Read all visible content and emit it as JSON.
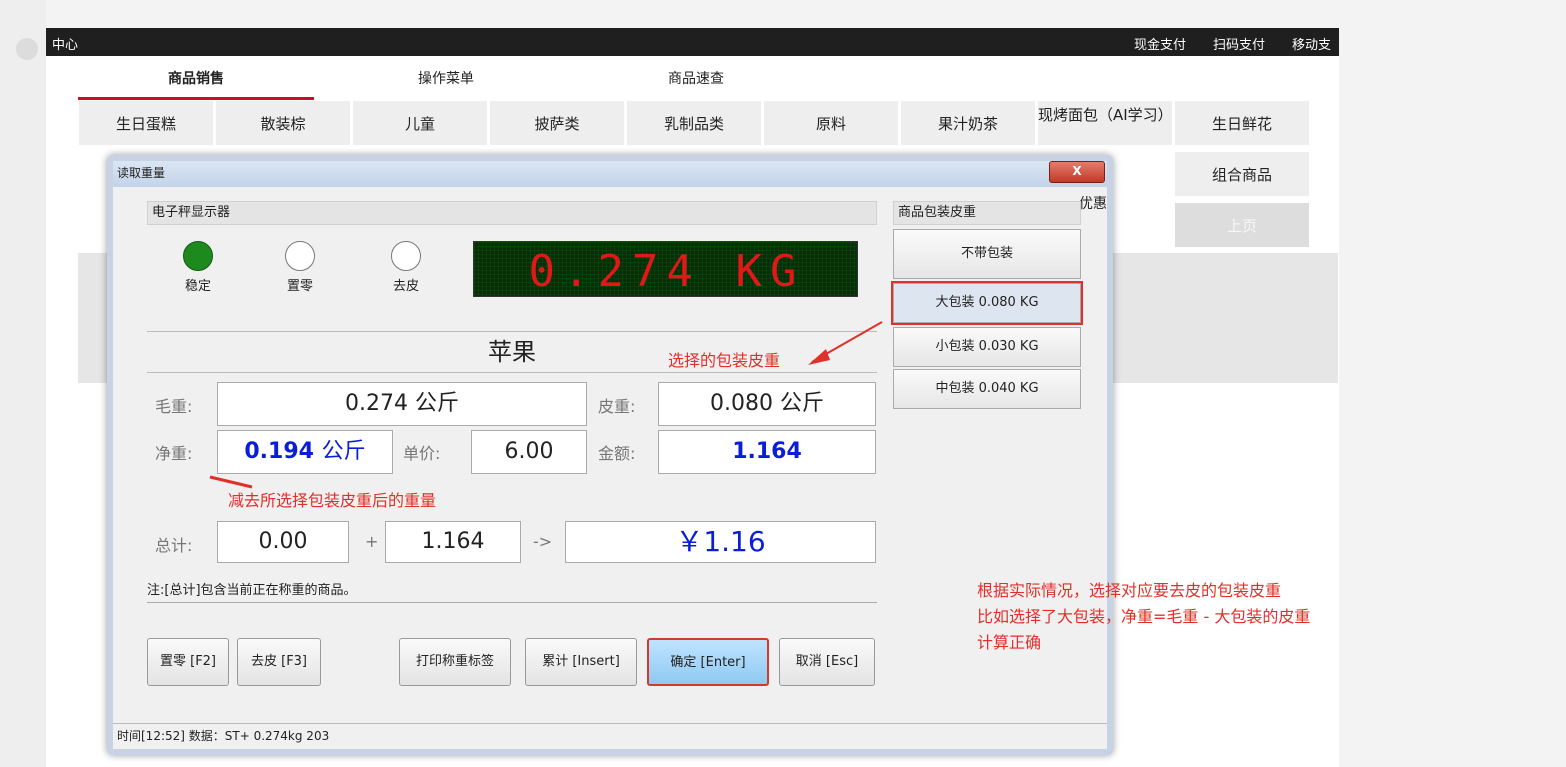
{
  "app": {
    "title": "中心",
    "pay_buttons": [
      "现金支付",
      "扫码支付",
      "移动支"
    ]
  },
  "nav_tabs": [
    "商品销售",
    "操作菜单",
    "商品速查"
  ],
  "categories_row1": [
    "生日蛋糕",
    "散装棕",
    "儿童",
    "披萨类",
    "乳制品类",
    "原料",
    "果汁奶茶",
    "现烤面包（AI学习）",
    "生日鲜花"
  ],
  "categories_row2_visible": [
    "优惠",
    "组合商品"
  ],
  "page_up": "上页",
  "dialog": {
    "title": "读取重量",
    "close": "X",
    "scale": {
      "header": "电子秤显示器",
      "indicators": [
        {
          "label": "稳定",
          "on": true
        },
        {
          "label": "置零",
          "on": false
        },
        {
          "label": "去皮",
          "on": false
        }
      ],
      "display": "0.274 KG",
      "display_color": "#e01818"
    },
    "product_name": "苹果",
    "gross_label": "毛重:",
    "gross_value": "0.274 公斤",
    "tare_label": "皮重:",
    "tare_value": "0.080 公斤",
    "net_label": "净重:",
    "net_value": "0.194",
    "net_unit": "公斤",
    "price_label": "单价:",
    "price_value": "6.00",
    "amount_label": "金额:",
    "amount_value": "1.164",
    "total_label": "总计:",
    "total_value": "0.00",
    "plus": "+",
    "add_value": "1.164",
    "arrow": "->",
    "grand_total": "￥1.16",
    "note": "注:[总计]包含当前正在称重的商品。",
    "buttons": {
      "zero": "置零 [F2]",
      "tare": "去皮 [F3]",
      "print": "打印称重标签",
      "accumulate": "累计 [Insert]",
      "confirm": "确定 [Enter]",
      "cancel": "取消 [Esc]"
    },
    "status": "时间[12:52] 数据：ST+ 0.274kg  203",
    "packaging": {
      "header": "商品包装皮重",
      "options": [
        "不带包装",
        "大包装 0.080 KG",
        "小包装 0.030 KG",
        "中包装 0.040 KG"
      ],
      "selected_index": 1
    }
  },
  "annotations": {
    "selected_tare": "选择的包装皮重",
    "net_explain": "减去所选择包装皮重后的重量",
    "side_note_1": "根据实际情况，选择对应要去皮的包装皮重",
    "side_note_2": "比如选择了大包装，净重=毛重 - 大包装的皮重",
    "side_note_3": "计算正确"
  }
}
